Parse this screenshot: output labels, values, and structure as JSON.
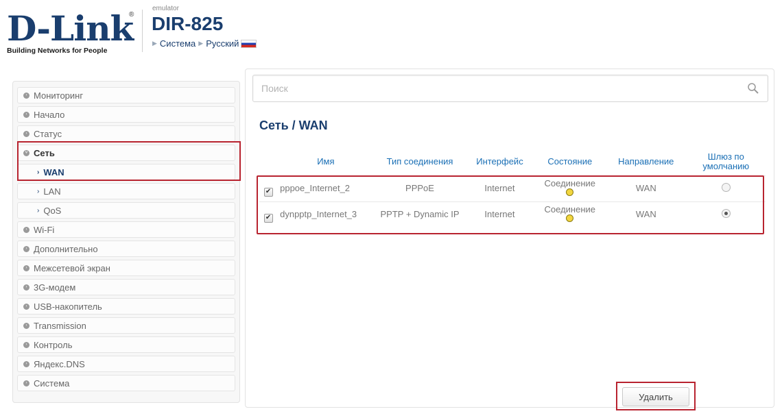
{
  "header": {
    "logo_text": "D-Link",
    "logo_tagline": "Building Networks for People",
    "emulator_label": "emulator",
    "model": "DIR-825",
    "breadcrumb_system": "Система",
    "breadcrumb_language": "Русский"
  },
  "sidebar": {
    "items": [
      {
        "label": "Мониторинг"
      },
      {
        "label": "Начало"
      },
      {
        "label": "Статус"
      },
      {
        "label": "Сеть"
      },
      {
        "label": "WAN"
      },
      {
        "label": "LAN"
      },
      {
        "label": "QoS"
      },
      {
        "label": "Wi-Fi"
      },
      {
        "label": "Дополнительно"
      },
      {
        "label": "Межсетевой экран"
      },
      {
        "label": "3G-модем"
      },
      {
        "label": "USB-накопитель"
      },
      {
        "label": "Transmission"
      },
      {
        "label": "Контроль"
      },
      {
        "label": "Яндекс.DNS"
      },
      {
        "label": "Система"
      }
    ]
  },
  "main": {
    "search_placeholder": "Поиск",
    "title": "Сеть /  WAN",
    "table": {
      "headers": [
        "Имя",
        "Тип соединения",
        "Интерфейс",
        "Состояние",
        "Направление",
        "Шлюз по умолчанию"
      ],
      "rows": [
        {
          "checked": true,
          "name": "pppoe_Internet_2",
          "type": "PPPoE",
          "interface": "Internet",
          "state": "Соединение",
          "direction": "WAN",
          "default_gw": false
        },
        {
          "checked": true,
          "name": "dynpptp_Internet_3",
          "type": "PPTP + Dynamic IP",
          "interface": "Internet",
          "state": "Соединение",
          "direction": "WAN",
          "default_gw": true
        }
      ]
    },
    "delete_label": "Удалить"
  },
  "colors": {
    "brand_blue": "#1a3e6e",
    "header_link_blue": "#1a6fb5",
    "highlight_red": "#b8232f",
    "status_yellow": "#f2d640"
  }
}
